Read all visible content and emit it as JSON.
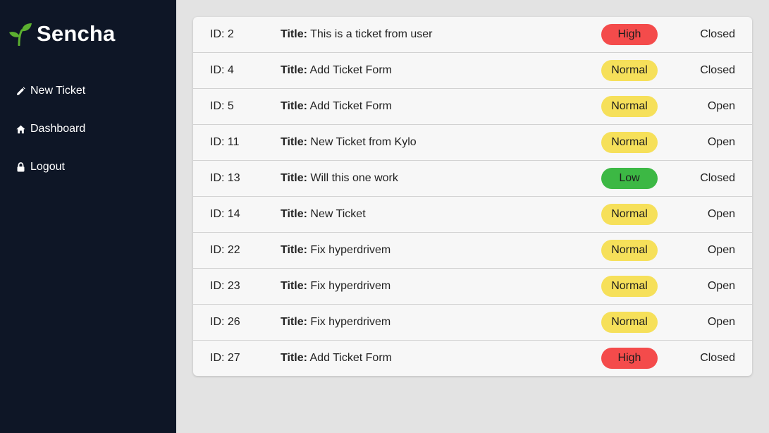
{
  "brand": {
    "name": "Sencha",
    "icon": "sprout-icon",
    "accent": "#5cb030"
  },
  "sidebar": {
    "items": [
      {
        "label": "New Ticket",
        "icon": "pencil-icon"
      },
      {
        "label": "Dashboard",
        "icon": "home-icon"
      },
      {
        "label": "Logout",
        "icon": "lock-icon"
      }
    ]
  },
  "colors": {
    "sidebar_bg": "#0e1626",
    "page_bg": "#e3e3e3",
    "high": "#f44b4b",
    "normal": "#f6e05a",
    "low": "#3cb844"
  },
  "tickets": {
    "title_label": "Title:",
    "rows": [
      {
        "id": "ID: 2",
        "title": "This is a ticket from user",
        "priority": "High",
        "status": "Closed"
      },
      {
        "id": "ID: 4",
        "title": "Add Ticket Form",
        "priority": "Normal",
        "status": "Closed"
      },
      {
        "id": "ID: 5",
        "title": "Add Ticket Form",
        "priority": "Normal",
        "status": "Open"
      },
      {
        "id": "ID: 11",
        "title": "New Ticket from Kylo",
        "priority": "Normal",
        "status": "Open"
      },
      {
        "id": "ID: 13",
        "title": "Will this one work",
        "priority": "Low",
        "status": "Closed"
      },
      {
        "id": "ID: 14",
        "title": "New Ticket",
        "priority": "Normal",
        "status": "Open"
      },
      {
        "id": "ID: 22",
        "title": "Fix hyperdrivem",
        "priority": "Normal",
        "status": "Open"
      },
      {
        "id": "ID: 23",
        "title": "Fix hyperdrivem",
        "priority": "Normal",
        "status": "Open"
      },
      {
        "id": "ID: 26",
        "title": "Fix hyperdrivem",
        "priority": "Normal",
        "status": "Open"
      },
      {
        "id": "ID: 27",
        "title": "Add Ticket Form",
        "priority": "High",
        "status": "Closed"
      }
    ]
  }
}
